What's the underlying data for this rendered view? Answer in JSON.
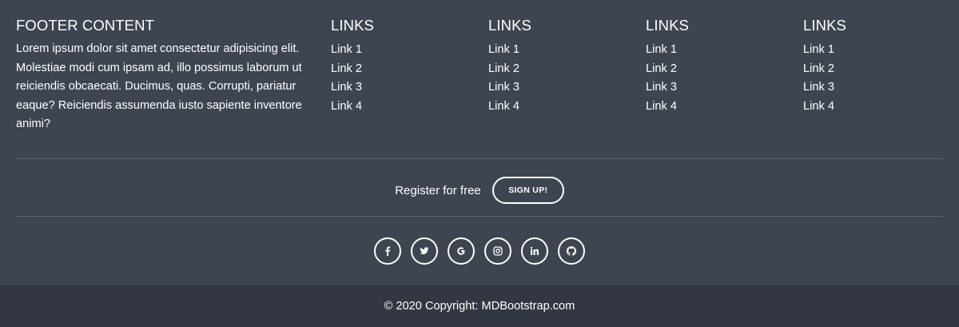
{
  "about": {
    "title": "FOOTER CONTENT",
    "text": "Lorem ipsum dolor sit amet consectetur adipisicing elit. Molestiae modi cum ipsam ad, illo possimus laborum ut reiciendis obcaecati. Ducimus, quas. Corrupti, pariatur eaque? Reiciendis assumenda iusto sapiente inventore animi?"
  },
  "link_columns": [
    {
      "title": "LINKS",
      "links": [
        "Link 1",
        "Link 2",
        "Link 3",
        "Link 4"
      ]
    },
    {
      "title": "LINKS",
      "links": [
        "Link 1",
        "Link 2",
        "Link 3",
        "Link 4"
      ]
    },
    {
      "title": "LINKS",
      "links": [
        "Link 1",
        "Link 2",
        "Link 3",
        "Link 4"
      ]
    },
    {
      "title": "LINKS",
      "links": [
        "Link 1",
        "Link 2",
        "Link 3",
        "Link 4"
      ]
    }
  ],
  "register": {
    "text": "Register for free",
    "button_label": "SIGN UP!"
  },
  "social": [
    {
      "icon": "facebook-icon"
    },
    {
      "icon": "twitter-icon"
    },
    {
      "icon": "google-icon"
    },
    {
      "icon": "instagram-icon"
    },
    {
      "icon": "linkedin-icon"
    },
    {
      "icon": "github-icon"
    }
  ],
  "copyright": {
    "prefix": "© 2020 Copyright: ",
    "link_text": "MDBootstrap.com"
  },
  "colors": {
    "footer_bg": "#3e4551",
    "copyright_bg": "#323741",
    "text": "#ffffff",
    "divider": "#5f6571"
  }
}
